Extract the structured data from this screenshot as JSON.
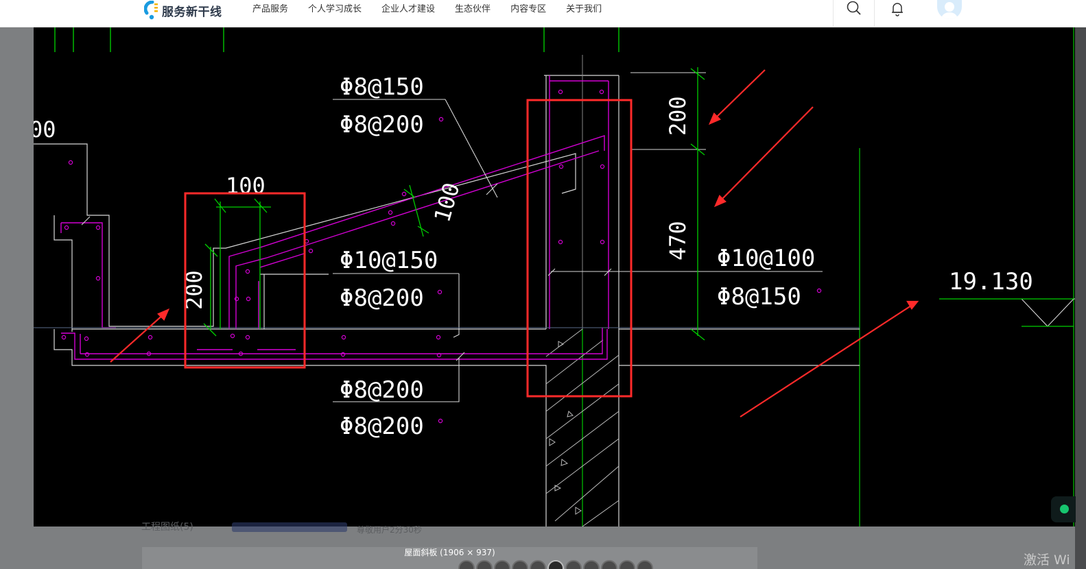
{
  "header": {
    "brand": "服务新干线",
    "nav": [
      "产品服务",
      "个人学习成长",
      "企业人才建设",
      "生态伙伴",
      "内容专区",
      "关于我们"
    ],
    "icons": [
      "search-icon",
      "bell-icon",
      "avatar"
    ]
  },
  "drawing": {
    "rebar_labels": [
      "Φ8@150",
      "Φ8@200",
      "Φ10@150",
      "Φ8@200",
      "Φ8@200",
      "Φ8@200",
      "Φ10@100",
      "Φ8@150"
    ],
    "dimensions": [
      "100",
      "200",
      "100",
      "200",
      "470",
      "00"
    ],
    "elevation": "19.130"
  },
  "page_under": {
    "text_left": "工程图纸(5)",
    "text_right": "尊敬用户2分30秒"
  },
  "viewer": {
    "caption": "屋面斜板 (1906 × 937)",
    "thumb_count": 11,
    "active_thumb": 5
  },
  "system": {
    "watermark": "激活 Wi"
  },
  "colors": {
    "drawing_bg": "#000000",
    "rebar": "#d400d4",
    "green_dim": "#00d000",
    "highlight_red": "#ff2a2a",
    "nav_text": "#333333",
    "online": "#17c56f"
  }
}
